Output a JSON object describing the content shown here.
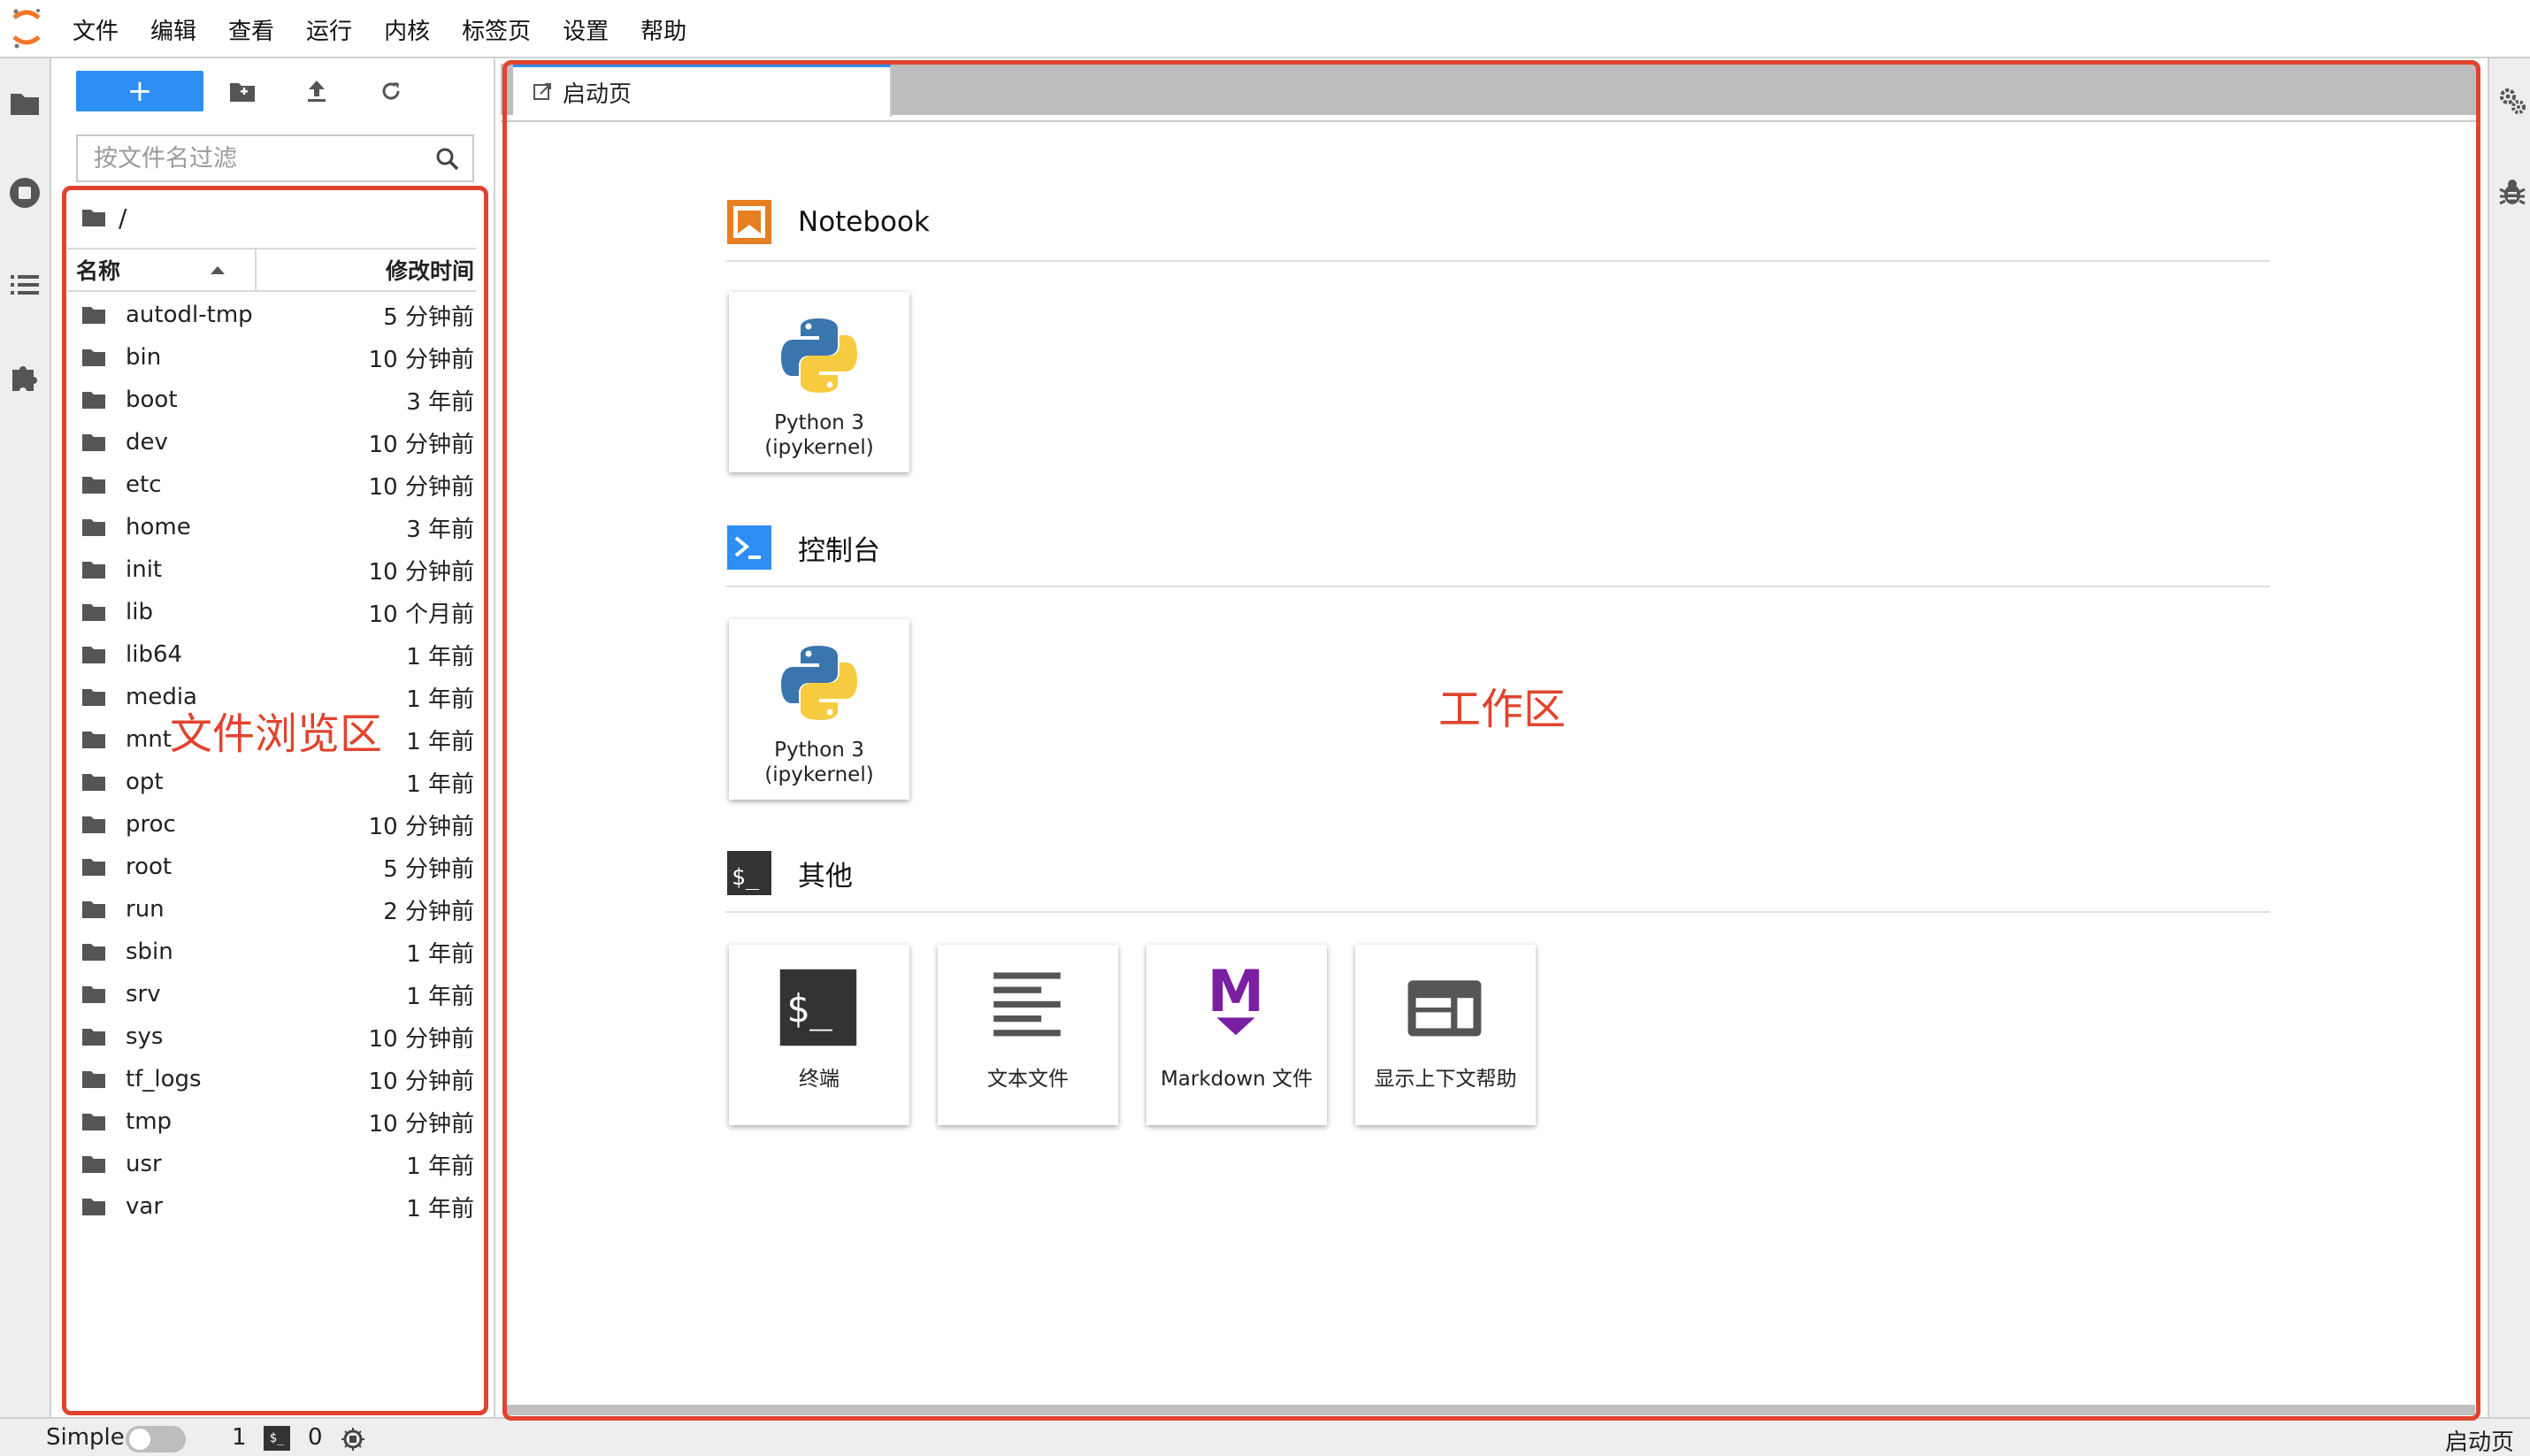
{
  "menubar": {
    "items": [
      "文件",
      "编辑",
      "查看",
      "运行",
      "内核",
      "标签页",
      "设置",
      "帮助"
    ]
  },
  "filebrowser": {
    "new_label": "+",
    "filter_placeholder": "按文件名过滤",
    "breadcrumb": "/",
    "col_name": "名称",
    "col_modified": "修改时间",
    "files": [
      {
        "name": "autodl-tmp",
        "modified": "5 分钟前"
      },
      {
        "name": "bin",
        "modified": "10 分钟前"
      },
      {
        "name": "boot",
        "modified": "3 年前"
      },
      {
        "name": "dev",
        "modified": "10 分钟前"
      },
      {
        "name": "etc",
        "modified": "10 分钟前"
      },
      {
        "name": "home",
        "modified": "3 年前"
      },
      {
        "name": "init",
        "modified": "10 分钟前"
      },
      {
        "name": "lib",
        "modified": "10 个月前"
      },
      {
        "name": "lib64",
        "modified": "1 年前"
      },
      {
        "name": "media",
        "modified": "1 年前"
      },
      {
        "name": "mnt",
        "modified": "1 年前"
      },
      {
        "name": "opt",
        "modified": "1 年前"
      },
      {
        "name": "proc",
        "modified": "10 分钟前"
      },
      {
        "name": "root",
        "modified": "5 分钟前"
      },
      {
        "name": "run",
        "modified": "2 分钟前"
      },
      {
        "name": "sbin",
        "modified": "1 年前"
      },
      {
        "name": "srv",
        "modified": "1 年前"
      },
      {
        "name": "sys",
        "modified": "10 分钟前"
      },
      {
        "name": "tf_logs",
        "modified": "10 分钟前"
      },
      {
        "name": "tmp",
        "modified": "10 分钟前"
      },
      {
        "name": "usr",
        "modified": "1 年前"
      },
      {
        "name": "var",
        "modified": "1 年前"
      }
    ]
  },
  "main": {
    "tab_label": "启动页",
    "sections": [
      {
        "title": "Notebook",
        "cards": [
          {
            "label_line1": "Python 3",
            "label_line2": "(ipykernel)"
          }
        ]
      },
      {
        "title": "控制台",
        "cards": [
          {
            "label_line1": "Python 3",
            "label_line2": "(ipykernel)"
          }
        ]
      },
      {
        "title": "其他",
        "cards": [
          {
            "label": "终端"
          },
          {
            "label": "文本文件"
          },
          {
            "label": "Markdown 文件"
          },
          {
            "label": "显示上下文帮助"
          }
        ]
      }
    ],
    "terminal_icon_text": "$_",
    "markdown_icon_text": "M"
  },
  "statusbar": {
    "simple_label": "Simple",
    "terminals_count": "1",
    "terminal_icon_text": "$_",
    "kernels_count": "0",
    "right_label": "启动页"
  },
  "annotations": {
    "file_browser_label": "文件浏览区",
    "work_area_label": "工作区",
    "color": "#e0442f"
  },
  "colors": {
    "accent_blue": "#2d8ef4",
    "notebook_orange": "#e67e22",
    "console_blue": "#2d8ef4",
    "markdown_purple": "#7b1fa2"
  }
}
